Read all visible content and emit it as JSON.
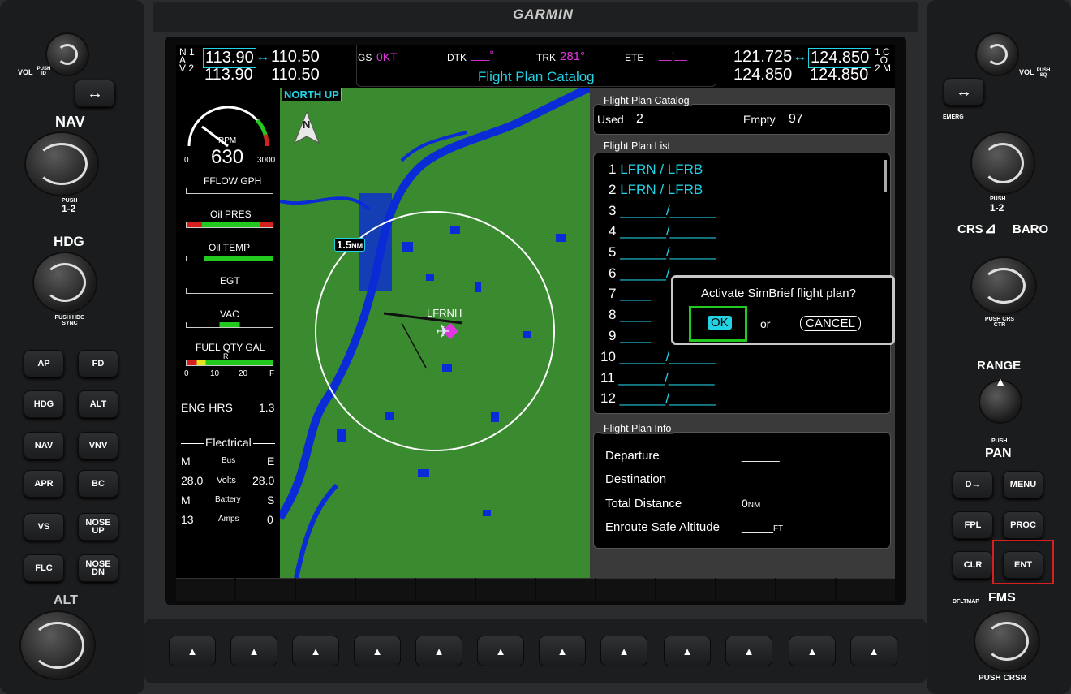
{
  "bezel": {
    "brand": "GARMIN",
    "left_labels": {
      "vol": "VOL",
      "vol_push": "PUSH ID",
      "nav": "NAV",
      "nav_push": "PUSH",
      "nav_push2": "1-2",
      "hdg": "HDG",
      "hdg_push": "PUSH HDG SYNC",
      "alt": "ALT"
    },
    "right_labels": {
      "vol": "VOL",
      "vol_push": "PUSH SQ",
      "emerg": "EMERG",
      "push12": "PUSH",
      "push12b": "1-2",
      "crs": "CRS",
      "baro": "BARO",
      "crs_push": "PUSH CRS CTR",
      "range": "RANGE",
      "pan_push": "PUSH",
      "pan": "PAN",
      "dfltmap": "DFLTMAP",
      "fms": "FMS",
      "fms_push": "PUSH CRSR"
    },
    "left_buttons": [
      [
        "AP",
        "FD"
      ],
      [
        "HDG",
        "ALT"
      ],
      [
        "NAV",
        "VNV"
      ],
      [
        "APR",
        "BC"
      ],
      [
        "VS",
        "NOSE UP"
      ],
      [
        "FLC",
        "NOSE DN"
      ]
    ],
    "right_buttons": [
      [
        "D→",
        "MENU"
      ],
      [
        "FPL",
        "PROC"
      ],
      [
        "CLR",
        "ENT"
      ]
    ],
    "swap_icon": "↔",
    "softkey_arrow": "▲"
  },
  "header": {
    "nav1_active": "113.90",
    "nav1_standby": "110.50",
    "nav2_active": "113.90",
    "nav2_standby": "110.50",
    "nav_label_n": "N",
    "nav_label_a": "A",
    "nav_label_v": "V",
    "nav_label_1": "1",
    "nav_label_2": "2",
    "gs_label": "GS",
    "gs_value": "0KT",
    "dtk_label": "DTK",
    "dtk_value": "___°",
    "trk_label": "TRK",
    "trk_value": "281°",
    "ete_label": "ETE",
    "ete_value": "__:__",
    "page_title": "Flight Plan Catalog",
    "com1_active": "121.725",
    "com1_standby": "124.850",
    "com2_active": "124.850",
    "com2_standby": "124.850",
    "com_label_c": "C",
    "com_label_o": "O",
    "com_label_m": "M",
    "com_label_1": "1",
    "com_label_2": "2"
  },
  "eis": {
    "rpm_label": "RPM",
    "rpm_value": "630",
    "rpm_min": "0",
    "rpm_max": "3000",
    "fflow": "FFLOW GPH",
    "oil_pres": "Oil PRES",
    "oil_temp": "Oil TEMP",
    "egt": "EGT",
    "vac": "VAC",
    "fuel_qty": "FUEL QTY GAL",
    "fuel_0": "0",
    "fuel_10": "10",
    "fuel_20": "20",
    "fuel_f": "F",
    "fuel_r": "R",
    "eng_hrs_label": "ENG HRS",
    "eng_hrs_value": "1.3",
    "electrical": "Electrical",
    "bus_label": "Bus",
    "bus_m": "M",
    "bus_e": "E",
    "volts_label": "Volts",
    "volts_m": "28.0",
    "volts_e": "28.0",
    "battery_label": "Battery",
    "bat_m": "M",
    "bat_s": "S",
    "amps_label": "Amps",
    "amps_m": "13",
    "amps_s": "0"
  },
  "map": {
    "orientation": "NORTH UP",
    "north": "N",
    "range": "1.5",
    "range_unit": "NM",
    "airport": "LFRNH"
  },
  "catalog": {
    "title": "Flight Plan Catalog",
    "used_label": "Used",
    "used_value": "2",
    "empty_label": "Empty",
    "empty_value": "97"
  },
  "list": {
    "title": "Flight Plan List",
    "items": [
      {
        "num": "1",
        "route": "LFRN / LFRB"
      },
      {
        "num": "2",
        "route": "LFRN / LFRB"
      },
      {
        "num": "3",
        "route": "______/______"
      },
      {
        "num": "4",
        "route": "______/______"
      },
      {
        "num": "5",
        "route": "______/______"
      },
      {
        "num": "6",
        "route": "______/"
      },
      {
        "num": "7",
        "route": "____"
      },
      {
        "num": "8",
        "route": "____"
      },
      {
        "num": "9",
        "route": "____"
      },
      {
        "num": "10",
        "route": "______/______"
      },
      {
        "num": "11",
        "route": "______/______"
      },
      {
        "num": "12",
        "route": "______/______"
      }
    ]
  },
  "info": {
    "title": "Flight Plan Info",
    "departure_label": "Departure",
    "departure_value": "______",
    "destination_label": "Destination",
    "destination_value": "______",
    "distance_label": "Total Distance",
    "distance_value": "0",
    "distance_unit": "NM",
    "esa_label": "Enroute Safe Altitude",
    "esa_value": "_____",
    "esa_unit": "FT"
  },
  "dialog": {
    "message": "Activate SimBrief flight plan?",
    "ok": "OK",
    "or": "or",
    "cancel": "CANCEL"
  },
  "colors": {
    "cyan": "#22d3e6",
    "magenta": "#e036e0",
    "map_land": "#3a8a2f",
    "water": "#0a2bd6",
    "highlight_green": "#22c91e",
    "highlight_red": "#d62020"
  }
}
